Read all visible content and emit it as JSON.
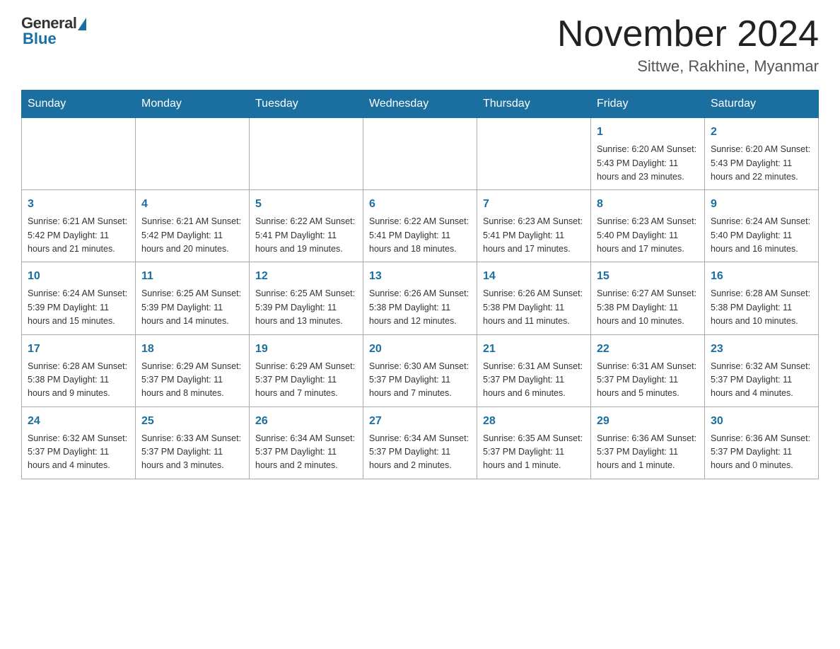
{
  "header": {
    "logo": {
      "general": "General",
      "blue": "Blue"
    },
    "title": "November 2024",
    "location": "Sittwe, Rakhine, Myanmar"
  },
  "calendar": {
    "weekdays": [
      "Sunday",
      "Monday",
      "Tuesday",
      "Wednesday",
      "Thursday",
      "Friday",
      "Saturday"
    ],
    "weeks": [
      [
        {
          "day": "",
          "info": ""
        },
        {
          "day": "",
          "info": ""
        },
        {
          "day": "",
          "info": ""
        },
        {
          "day": "",
          "info": ""
        },
        {
          "day": "",
          "info": ""
        },
        {
          "day": "1",
          "info": "Sunrise: 6:20 AM\nSunset: 5:43 PM\nDaylight: 11 hours\nand 23 minutes."
        },
        {
          "day": "2",
          "info": "Sunrise: 6:20 AM\nSunset: 5:43 PM\nDaylight: 11 hours\nand 22 minutes."
        }
      ],
      [
        {
          "day": "3",
          "info": "Sunrise: 6:21 AM\nSunset: 5:42 PM\nDaylight: 11 hours\nand 21 minutes."
        },
        {
          "day": "4",
          "info": "Sunrise: 6:21 AM\nSunset: 5:42 PM\nDaylight: 11 hours\nand 20 minutes."
        },
        {
          "day": "5",
          "info": "Sunrise: 6:22 AM\nSunset: 5:41 PM\nDaylight: 11 hours\nand 19 minutes."
        },
        {
          "day": "6",
          "info": "Sunrise: 6:22 AM\nSunset: 5:41 PM\nDaylight: 11 hours\nand 18 minutes."
        },
        {
          "day": "7",
          "info": "Sunrise: 6:23 AM\nSunset: 5:41 PM\nDaylight: 11 hours\nand 17 minutes."
        },
        {
          "day": "8",
          "info": "Sunrise: 6:23 AM\nSunset: 5:40 PM\nDaylight: 11 hours\nand 17 minutes."
        },
        {
          "day": "9",
          "info": "Sunrise: 6:24 AM\nSunset: 5:40 PM\nDaylight: 11 hours\nand 16 minutes."
        }
      ],
      [
        {
          "day": "10",
          "info": "Sunrise: 6:24 AM\nSunset: 5:39 PM\nDaylight: 11 hours\nand 15 minutes."
        },
        {
          "day": "11",
          "info": "Sunrise: 6:25 AM\nSunset: 5:39 PM\nDaylight: 11 hours\nand 14 minutes."
        },
        {
          "day": "12",
          "info": "Sunrise: 6:25 AM\nSunset: 5:39 PM\nDaylight: 11 hours\nand 13 minutes."
        },
        {
          "day": "13",
          "info": "Sunrise: 6:26 AM\nSunset: 5:38 PM\nDaylight: 11 hours\nand 12 minutes."
        },
        {
          "day": "14",
          "info": "Sunrise: 6:26 AM\nSunset: 5:38 PM\nDaylight: 11 hours\nand 11 minutes."
        },
        {
          "day": "15",
          "info": "Sunrise: 6:27 AM\nSunset: 5:38 PM\nDaylight: 11 hours\nand 10 minutes."
        },
        {
          "day": "16",
          "info": "Sunrise: 6:28 AM\nSunset: 5:38 PM\nDaylight: 11 hours\nand 10 minutes."
        }
      ],
      [
        {
          "day": "17",
          "info": "Sunrise: 6:28 AM\nSunset: 5:38 PM\nDaylight: 11 hours\nand 9 minutes."
        },
        {
          "day": "18",
          "info": "Sunrise: 6:29 AM\nSunset: 5:37 PM\nDaylight: 11 hours\nand 8 minutes."
        },
        {
          "day": "19",
          "info": "Sunrise: 6:29 AM\nSunset: 5:37 PM\nDaylight: 11 hours\nand 7 minutes."
        },
        {
          "day": "20",
          "info": "Sunrise: 6:30 AM\nSunset: 5:37 PM\nDaylight: 11 hours\nand 7 minutes."
        },
        {
          "day": "21",
          "info": "Sunrise: 6:31 AM\nSunset: 5:37 PM\nDaylight: 11 hours\nand 6 minutes."
        },
        {
          "day": "22",
          "info": "Sunrise: 6:31 AM\nSunset: 5:37 PM\nDaylight: 11 hours\nand 5 minutes."
        },
        {
          "day": "23",
          "info": "Sunrise: 6:32 AM\nSunset: 5:37 PM\nDaylight: 11 hours\nand 4 minutes."
        }
      ],
      [
        {
          "day": "24",
          "info": "Sunrise: 6:32 AM\nSunset: 5:37 PM\nDaylight: 11 hours\nand 4 minutes."
        },
        {
          "day": "25",
          "info": "Sunrise: 6:33 AM\nSunset: 5:37 PM\nDaylight: 11 hours\nand 3 minutes."
        },
        {
          "day": "26",
          "info": "Sunrise: 6:34 AM\nSunset: 5:37 PM\nDaylight: 11 hours\nand 2 minutes."
        },
        {
          "day": "27",
          "info": "Sunrise: 6:34 AM\nSunset: 5:37 PM\nDaylight: 11 hours\nand 2 minutes."
        },
        {
          "day": "28",
          "info": "Sunrise: 6:35 AM\nSunset: 5:37 PM\nDaylight: 11 hours\nand 1 minute."
        },
        {
          "day": "29",
          "info": "Sunrise: 6:36 AM\nSunset: 5:37 PM\nDaylight: 11 hours\nand 1 minute."
        },
        {
          "day": "30",
          "info": "Sunrise: 6:36 AM\nSunset: 5:37 PM\nDaylight: 11 hours\nand 0 minutes."
        }
      ]
    ]
  }
}
